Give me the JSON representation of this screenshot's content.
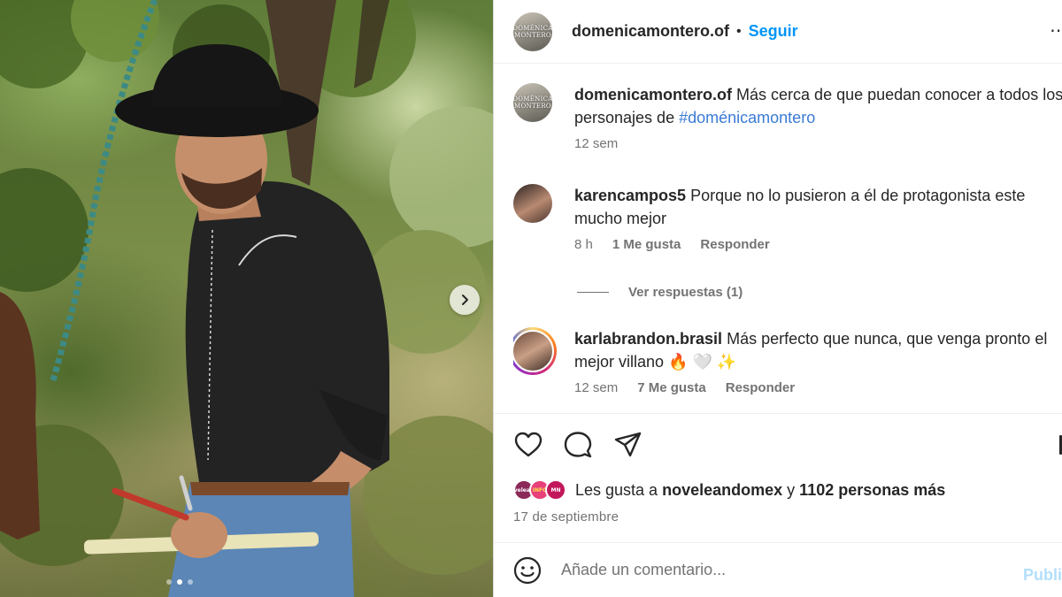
{
  "post": {
    "username": "domenicamontero.of",
    "follow_label": "Seguir",
    "separator": "•",
    "more_label": "⋯",
    "avatar_text": "DOMÉNICA MONTERO"
  },
  "caption": {
    "username": "domenicamontero.of",
    "text": "Más cerca de que puedan conocer a todos los personajes de",
    "hashtag": "#doménicamontero",
    "time": "12 sem"
  },
  "comments": [
    {
      "username": "karencampos5",
      "text": "Porque no lo pusieron a él de protagonista este mucho mejor",
      "time": "8 h",
      "likes": "1 Me gusta",
      "reply_label": "Responder"
    },
    {
      "username": "karlabrandon.brasil",
      "text": "Más perfecto que nunca, que venga pronto el mejor villano 🔥 🤍 ✨",
      "time": "12 sem",
      "likes": "7 Me gusta",
      "reply_label": "Responder"
    }
  ],
  "view_replies_label": "Ver respuestas (1)",
  "likes_summary": {
    "prefix": "Les gusta a",
    "user": "noveleandomex",
    "connector": "y",
    "others": "1102 personas más",
    "mini_avatars": [
      "noveleando",
      "INFO",
      "MN"
    ]
  },
  "date": "17 de septiembre",
  "add_comment": {
    "placeholder": "Añade un comentario...",
    "publish_label": "Publi"
  },
  "carousel": {
    "total_slides": 3,
    "active_slide": 2
  },
  "colors": {
    "link_blue": "#0095f6",
    "hashtag_blue": "#3a7bd5",
    "muted": "#737373",
    "text": "#262626"
  },
  "icons": [
    "chevron-right-icon",
    "heart-icon",
    "comment-icon",
    "share-icon",
    "emoji-icon",
    "more-icon"
  ]
}
